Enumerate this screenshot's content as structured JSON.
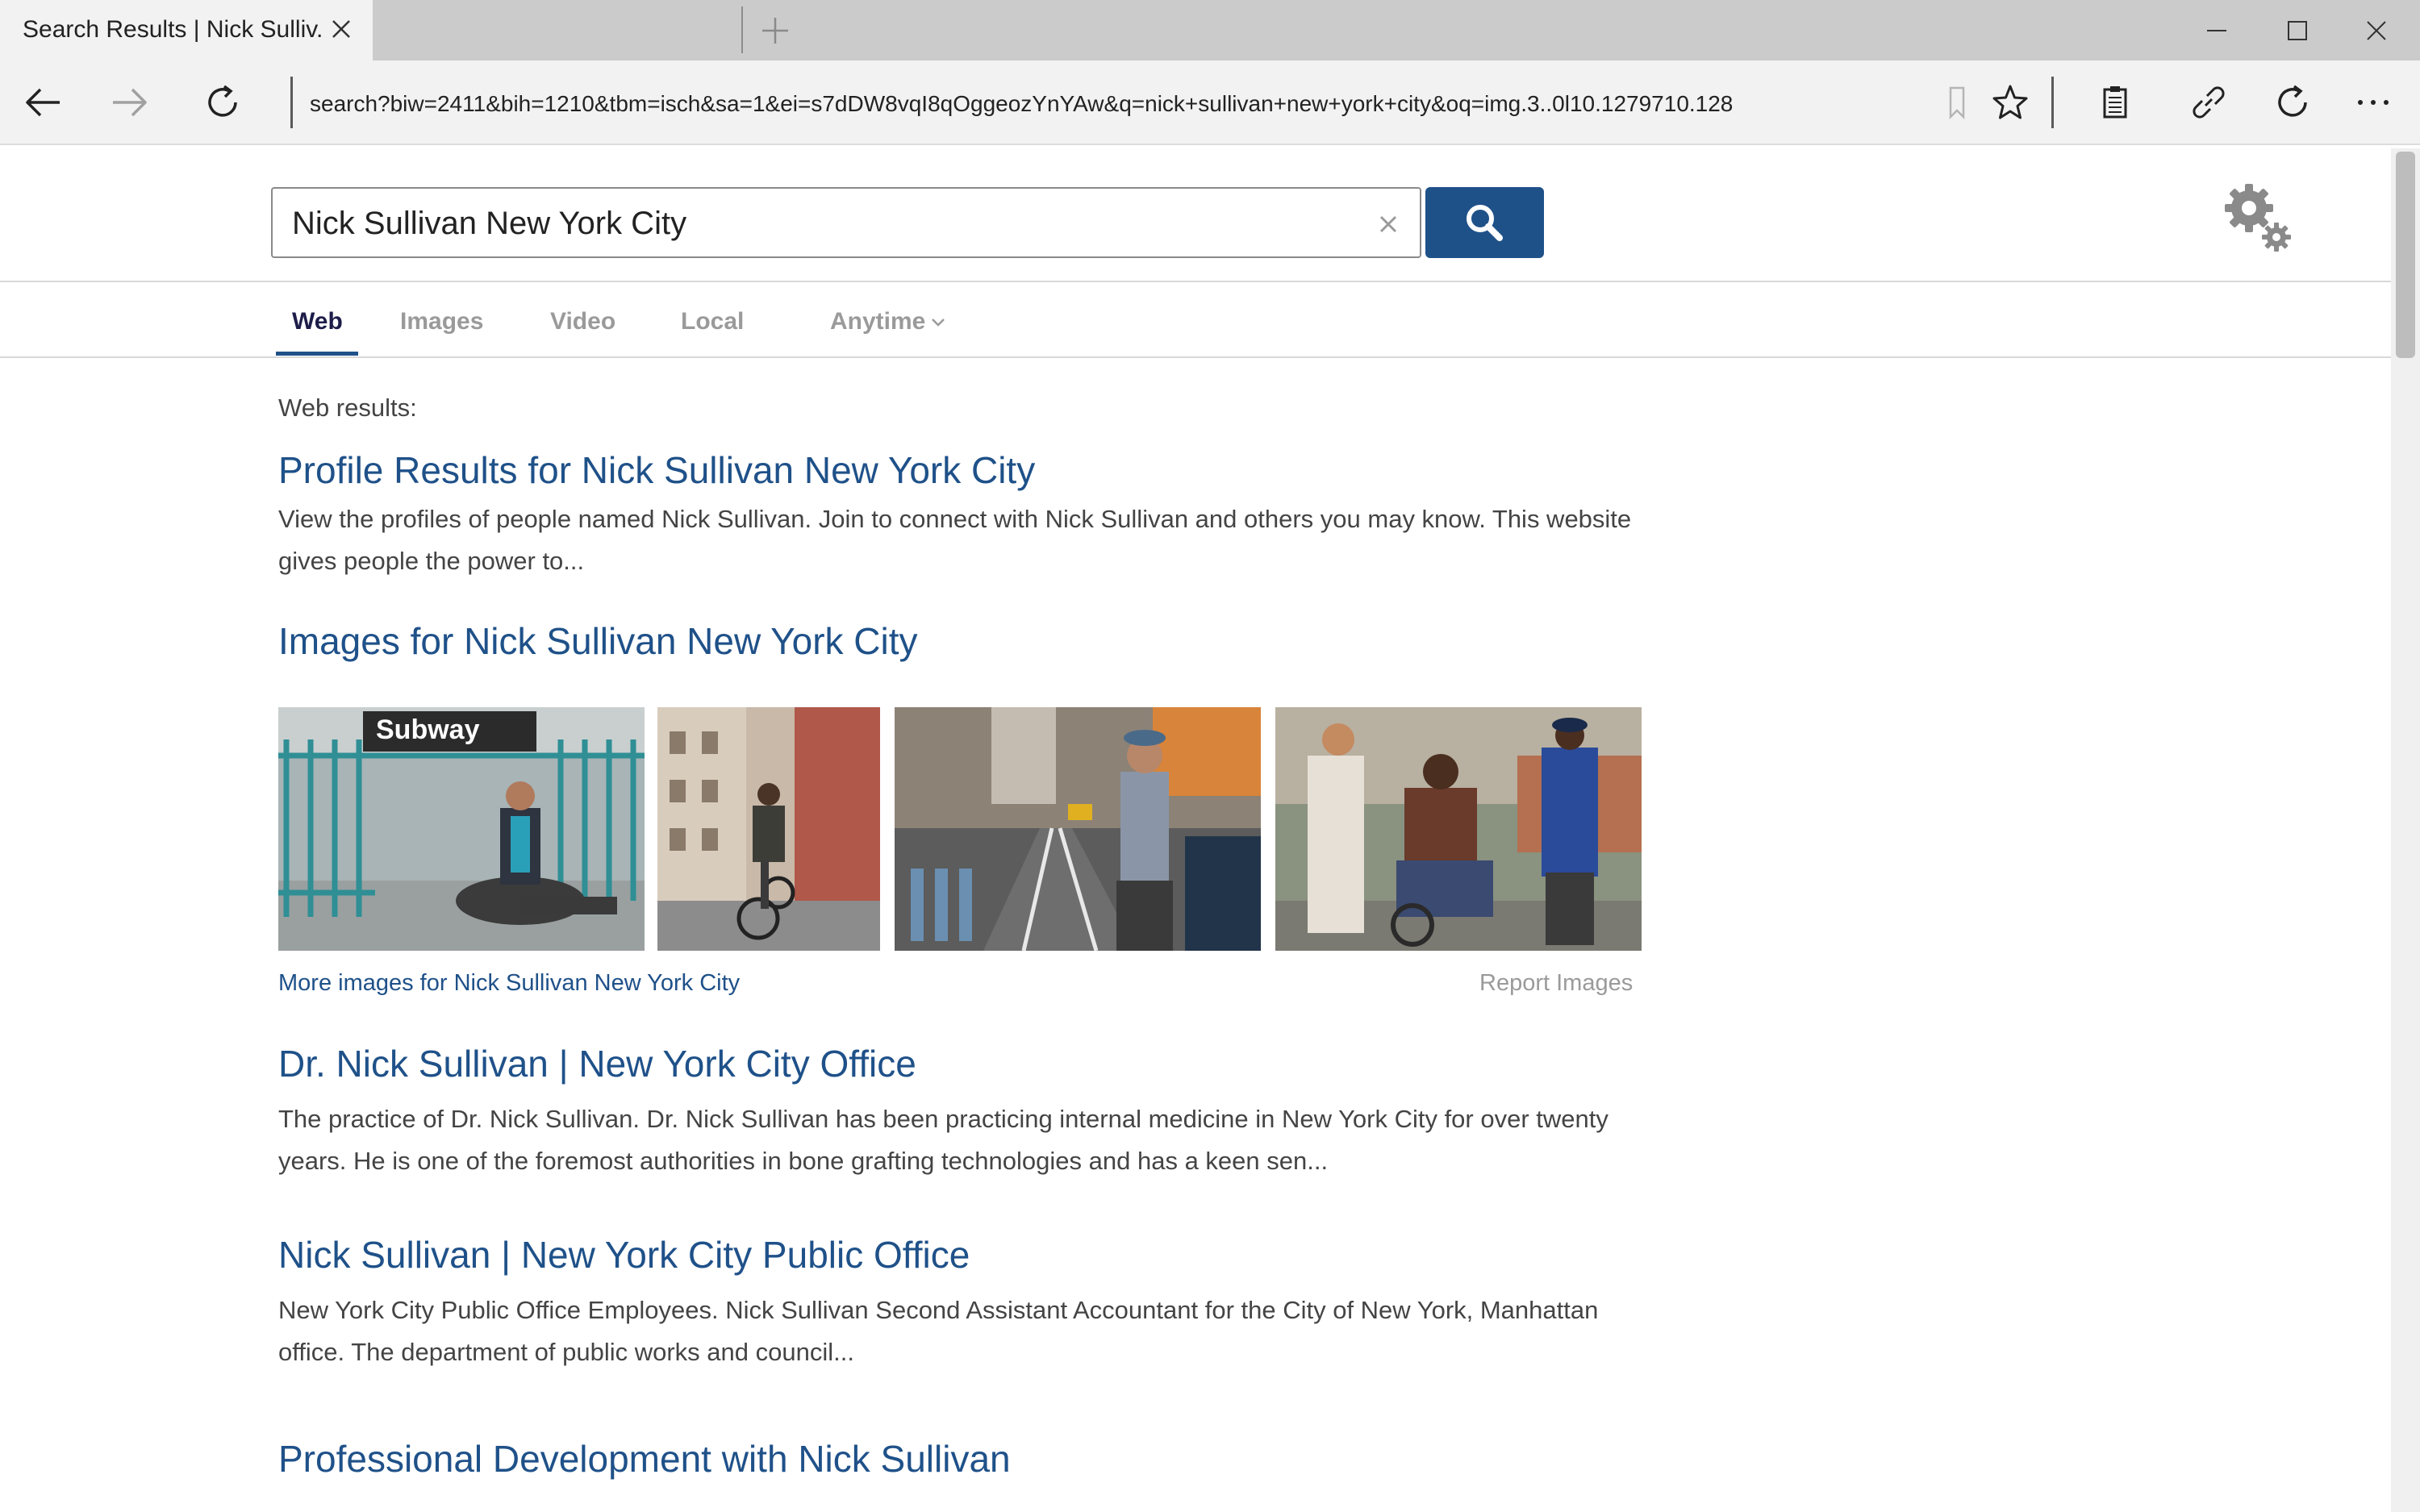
{
  "browser": {
    "tab_title": "Search Results | Nick Sulliv...",
    "url": "search?biw=2411&bih=1210&tbm=isch&sa=1&ei=s7dDW8vqI8qOggeozYnYAw&q=nick+sullivan+new+york+city&oq=img.3..0l10.1279710.128"
  },
  "search": {
    "query": "Nick Sullivan New York City"
  },
  "vertical_tabs": [
    {
      "label": "Web",
      "active": true
    },
    {
      "label": "Images",
      "active": false
    },
    {
      "label": "Video",
      "active": false
    },
    {
      "label": "Local",
      "active": false
    },
    {
      "label": "Anytime",
      "active": false
    }
  ],
  "results": {
    "section_label": "Web results:",
    "items": [
      {
        "title": "Profile Results for Nick Sullivan New York City",
        "description": "View the profiles of people named Nick Sullivan. Join  to connect with Nick Sullivan and others you may know. This website gives people the power to..."
      },
      {
        "title": "Images for Nick Sullivan New York City"
      },
      {
        "title": "Dr. Nick Sullivan | New York City Office",
        "description": "The practice of Dr. Nick Sullivan. Dr. Nick Sullivan has been practicing internal medicine in New York City for over twenty years. He is one of the foremost authorities in bone grafting technologies and has a keen sen..."
      },
      {
        "title": "Nick Sullivan | New York City Public Office",
        "description": "New York City Public Office Employees. Nick Sullivan Second Assistant Accountant for the City of New York, Manhattan office. The department of public works and council..."
      },
      {
        "title": "Professional Development with Nick Sullivan"
      }
    ],
    "images": {
      "subway_sign": "Subway",
      "more_link": "More images for Nick Sullivan New York City",
      "report_link": "Report Images"
    }
  },
  "colors": {
    "link": "#1f5189",
    "search_button": "#1f5189",
    "tab_strip": "#cbcbcb"
  },
  "icons": [
    "back-icon",
    "forward-icon",
    "refresh-icon",
    "reading-view-icon",
    "favorite-star-icon",
    "notes-icon",
    "share-link-icon",
    "cortana-icon",
    "more-icon",
    "search-icon",
    "clear-icon",
    "settings-gear-icon",
    "chevron-down-icon"
  ]
}
